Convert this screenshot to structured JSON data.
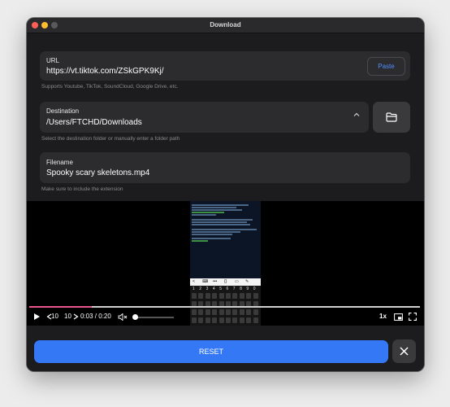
{
  "window": {
    "title": "Download"
  },
  "url": {
    "label": "URL",
    "value": "https://vt.tiktok.com/ZSkGPK9Kj/",
    "paste_label": "Paste",
    "helper": "Supports Youtube, TikTok, SoundCloud, Google Drive, etc."
  },
  "destination": {
    "label": "Destination",
    "value": "/Users/FTCHD/Downloads",
    "helper": "Select the destination folder or manually enter a folder path"
  },
  "filename": {
    "label": "Filename",
    "value": "Spooky scary skeletons.mp4",
    "helper": "Make sure to include the extension"
  },
  "player": {
    "skip_back": "10",
    "skip_forward": "10",
    "time": "0:03 / 0:20",
    "speed": "1x",
    "progress": 0.16,
    "volume": 0.0,
    "keyboard_numbers": [
      "1",
      "2",
      "3",
      "4",
      "5",
      "6",
      "7",
      "8",
      "9",
      "0"
    ]
  },
  "footer": {
    "reset_label": "RESET"
  },
  "colors": {
    "accent": "#3478f6",
    "progress": "#e9548f",
    "link": "#4f8cff"
  },
  "icons": [
    "folder-icon",
    "chevron-icon",
    "play-icon",
    "rewind-icon",
    "forward-icon",
    "mute-icon",
    "pip-icon",
    "fullscreen-icon",
    "close-icon"
  ]
}
